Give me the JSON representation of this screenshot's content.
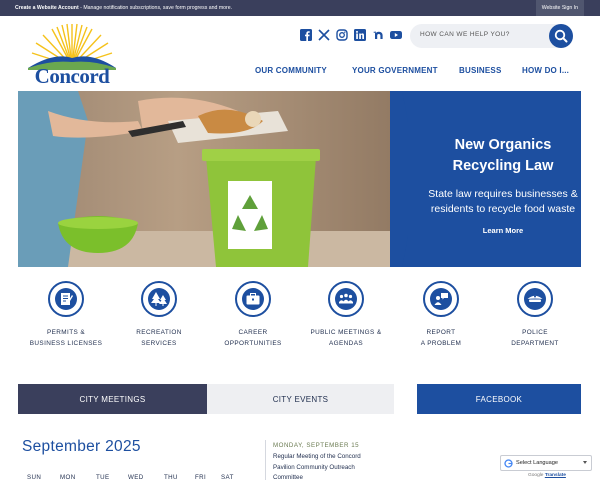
{
  "topbar": {
    "create_account": "Create a Website Account",
    "create_account_desc": " - Manage notification subscriptions, save form progress and more.",
    "sign_in": "Website Sign In"
  },
  "logo": {
    "wordmark": "Concord"
  },
  "social": [
    "facebook-icon",
    "x-icon",
    "instagram-icon",
    "linkedin-icon",
    "nextdoor-icon",
    "youtube-icon"
  ],
  "search": {
    "placeholder": "HOW CAN WE HELP YOU?"
  },
  "nav": [
    "OUR COMMUNITY",
    "YOUR GOVERNMENT",
    "BUSINESS",
    "HOW DO I..."
  ],
  "hero": {
    "title_line1": "New Organics",
    "title_line2": "Recycling Law",
    "subtitle_line1": "State law requires businesses &",
    "subtitle_line2": "residents to recycle food waste",
    "link": "Learn More"
  },
  "quick_links": [
    {
      "line1": "PERMITS &",
      "line2": "BUSINESS LICENSES",
      "icon": "permit-icon"
    },
    {
      "line1": "RECREATION",
      "line2": "SERVICES",
      "icon": "trees-icon"
    },
    {
      "line1": "CAREER",
      "line2": "OPPORTUNITIES",
      "icon": "briefcase-icon"
    },
    {
      "line1": "PUBLIC MEETINGS &",
      "line2": "AGENDAS",
      "icon": "meeting-icon"
    },
    {
      "line1": "REPORT",
      "line2": "A PROBLEM",
      "icon": "report-icon"
    },
    {
      "line1": "POLICE",
      "line2": "DEPARTMENT",
      "icon": "police-icon"
    }
  ],
  "tabs": {
    "meetings": "CITY MEETINGS",
    "events": "CITY EVENTS",
    "facebook": "FACEBOOK"
  },
  "calendar": {
    "month": "September 2025",
    "days": [
      "SUN",
      "MON",
      "TUE",
      "WED",
      "THU",
      "FRI",
      "SAT"
    ]
  },
  "event": {
    "date": "MONDAY, SEPTEMBER 15",
    "title": "Regular Meeting of the Concord Pavilion Community Outreach Committee"
  },
  "translate": {
    "select_label": "Select Language",
    "powered_by": "Google",
    "translate_link": "Translate"
  },
  "colors": {
    "brand_blue": "#1d4fa0",
    "dark_navy": "#3a3f5c",
    "hero_yellow": "#f5c21b"
  }
}
